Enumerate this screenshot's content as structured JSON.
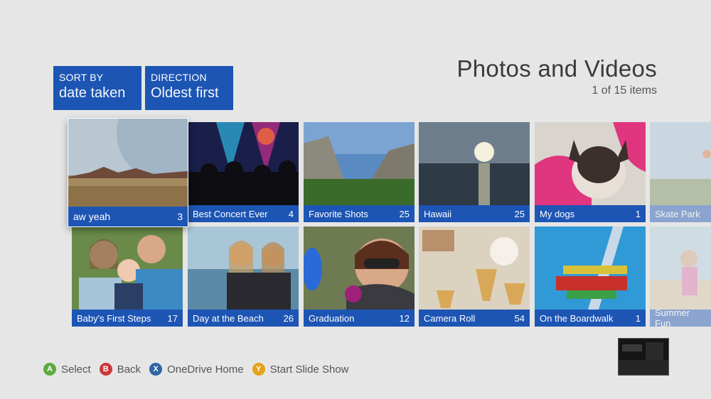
{
  "header": {
    "title": "Photos and Videos",
    "item_count": "1 of 15 items"
  },
  "sort": {
    "sort_by_label": "SORT BY",
    "sort_by_value": "date taken",
    "direction_label": "DIRECTION",
    "direction_value": "Oldest first"
  },
  "albums": [
    {
      "name": "aw yeah",
      "count": "3"
    },
    {
      "name": "Best Concert Ever",
      "count": "4"
    },
    {
      "name": "Favorite Shots",
      "count": "25"
    },
    {
      "name": "Hawaii",
      "count": "25"
    },
    {
      "name": "My dogs",
      "count": "1"
    },
    {
      "name": "Skate Park",
      "count": ""
    },
    {
      "name": "Baby's First Steps",
      "count": "17"
    },
    {
      "name": "Day at the Beach",
      "count": "26"
    },
    {
      "name": "Graduation",
      "count": "12"
    },
    {
      "name": "Camera Roll",
      "count": "54"
    },
    {
      "name": "On the Boardwalk",
      "count": "1"
    },
    {
      "name": "Summer Fun",
      "count": ""
    }
  ],
  "hints": [
    {
      "key": "A",
      "label": "Select",
      "color": "#5fa93f"
    },
    {
      "key": "B",
      "label": "Back",
      "color": "#c8393a"
    },
    {
      "key": "X",
      "label": "OneDrive Home",
      "color": "#2f64a6"
    },
    {
      "key": "Y",
      "label": "Start Slide Show",
      "color": "#e3a21a"
    }
  ]
}
